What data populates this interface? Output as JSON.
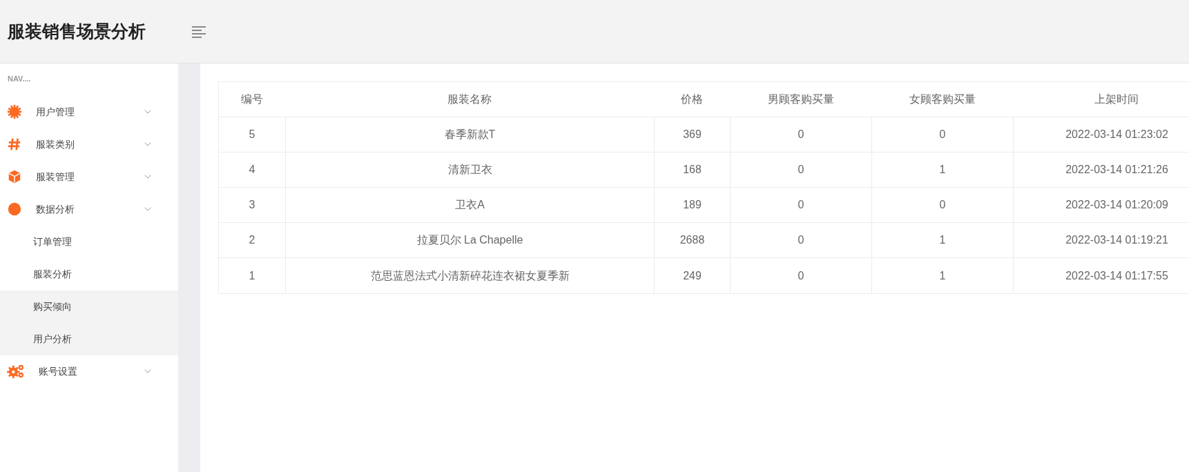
{
  "header": {
    "title": "服装销售场景分析"
  },
  "sidebar": {
    "heading": "NAV....",
    "items": [
      {
        "label": "用户管理"
      },
      {
        "label": "服装类别"
      },
      {
        "label": "服装管理"
      },
      {
        "label": "数据分析",
        "children": [
          {
            "label": "订单管理",
            "selected": false
          },
          {
            "label": "服装分析",
            "selected": false
          },
          {
            "label": "购买倾向",
            "selected": true
          },
          {
            "label": "用户分析",
            "selected": true
          }
        ]
      },
      {
        "label": "账号设置"
      }
    ]
  },
  "table": {
    "columns": [
      "编号",
      "服装名称",
      "价格",
      "男顾客购买量",
      "女顾客购买量",
      "上架时间"
    ],
    "rows": [
      [
        "5",
        "春季新款T",
        "369",
        "0",
        "0",
        "2022-03-14 01:23:02"
      ],
      [
        "4",
        "清新卫衣",
        "168",
        "0",
        "1",
        "2022-03-14 01:21:26"
      ],
      [
        "3",
        "卫衣A",
        "189",
        "0",
        "0",
        "2022-03-14 01:20:09"
      ],
      [
        "2",
        "拉夏贝尔 La Chapelle",
        "2688",
        "0",
        "1",
        "2022-03-14 01:19:21"
      ],
      [
        "1",
        "范思蓝恩法式小清新碎花连衣裙女夏季新",
        "249",
        "0",
        "1",
        "2022-03-14 01:17:55"
      ]
    ]
  }
}
